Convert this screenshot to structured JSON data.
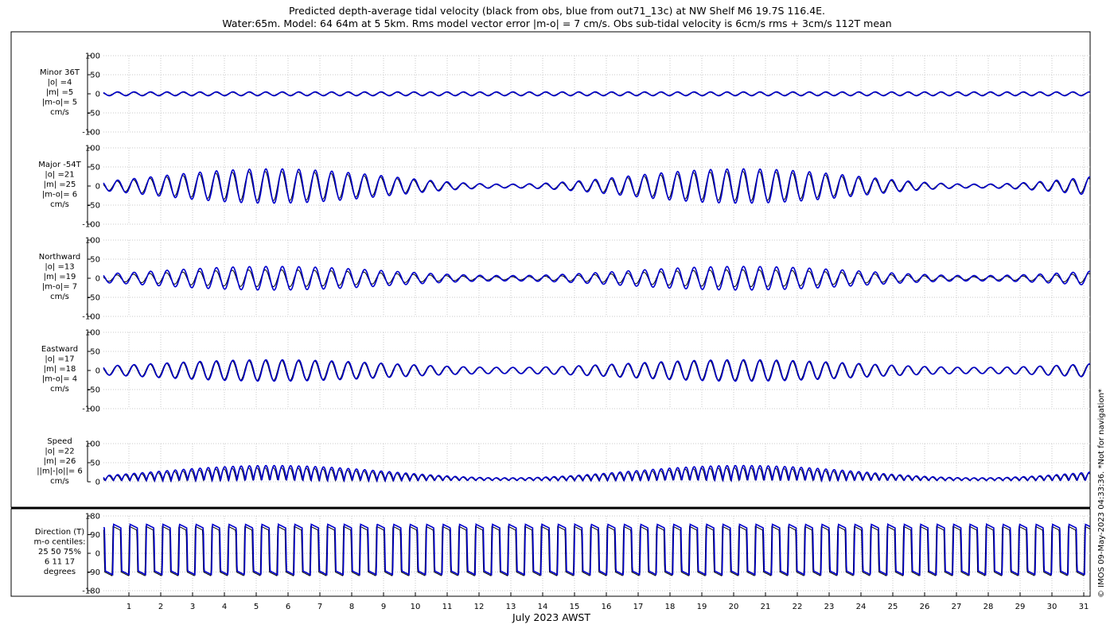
{
  "title": {
    "line1": "Predicted depth-average tidal velocity (black from obs, blue from out71_13c) at NW Shelf M6 19.7S 116.4E.",
    "line2": "Water:65m. Model: 64 64m at 5 5km. Rms model vector error |m-o| = 7 cm/s. Obs sub-tidal velocity is 6cm/s rms + 3cm/s 112T mean"
  },
  "footer": "© IMOS 09-May-2023 04:33:36. *Not for navigation*",
  "colors": {
    "obs": "#000000",
    "model": "#0000cc",
    "grid": "#c8c8c8"
  },
  "chart_data": {
    "type": "line",
    "xlabel": "July 2023 AWST",
    "xticks": [
      1,
      2,
      3,
      4,
      5,
      6,
      7,
      8,
      9,
      10,
      11,
      12,
      13,
      14,
      15,
      16,
      17,
      18,
      19,
      20,
      21,
      22,
      23,
      24,
      25,
      26,
      27,
      28,
      29,
      30,
      31
    ],
    "xlim": [
      0.2,
      31.2
    ],
    "grid": true,
    "series_legend": {
      "obs": "black from obs",
      "model": "blue from out71_13c"
    },
    "panels": [
      {
        "id": "minor",
        "label": [
          "Minor 36T",
          "|o| =4",
          "|m| =5",
          "|m-o|= 5",
          "cm/s"
        ],
        "ylim": [
          -100,
          100
        ],
        "yticks": [
          -100,
          -50,
          0,
          50,
          100
        ],
        "model": {
          "kind": "wave",
          "amp": 5,
          "spring_amp": 0,
          "offset": 0
        },
        "obs": {
          "kind": "wave",
          "amp": 4,
          "spring_amp": 0,
          "offset": 0
        }
      },
      {
        "id": "major",
        "label": [
          "Major -54T",
          "|o| =21",
          "|m| =25",
          "|m-o|= 6",
          "cm/s"
        ],
        "ylim": [
          -100,
          100
        ],
        "yticks": [
          -100,
          -50,
          0,
          50,
          100
        ],
        "model": {
          "kind": "wave",
          "amp": 25,
          "spring_amp": 20,
          "offset": 0
        },
        "obs": {
          "kind": "wave",
          "amp": 21,
          "spring_amp": 17,
          "offset": 0
        }
      },
      {
        "id": "northward",
        "label": [
          "Northward",
          "|o| =13",
          "|m| =19",
          "|m-o|= 7",
          "cm/s"
        ],
        "ylim": [
          -100,
          100
        ],
        "yticks": [
          -100,
          -50,
          0,
          50,
          100
        ],
        "model": {
          "kind": "wave",
          "amp": 19,
          "spring_amp": 12,
          "offset": 0
        },
        "obs": {
          "kind": "wave",
          "amp": 13,
          "spring_amp": 9,
          "offset": 0
        }
      },
      {
        "id": "eastward",
        "label": [
          "Eastward",
          "|o| =17",
          "|m| =18",
          "|m-o|= 4",
          "cm/s"
        ],
        "ylim": [
          -100,
          100
        ],
        "yticks": [
          -100,
          -50,
          0,
          50,
          100
        ],
        "model": {
          "kind": "wave",
          "amp": 18,
          "spring_amp": 10,
          "offset": 0
        },
        "obs": {
          "kind": "wave",
          "amp": 17,
          "spring_amp": 9,
          "offset": 0
        }
      },
      {
        "id": "speed",
        "label": [
          "Speed",
          "|o| =22",
          "|m| =26",
          "||m|-|o||= 6",
          "cm/s"
        ],
        "ylim": [
          0,
          100
        ],
        "yticks": [
          0,
          50,
          100
        ],
        "model": {
          "kind": "speed",
          "amp": 26,
          "spring_amp": 18,
          "offset": 0
        },
        "obs": {
          "kind": "speed",
          "amp": 22,
          "spring_amp": 15,
          "offset": 0
        }
      },
      {
        "id": "direction",
        "label": [
          "Direction (T)",
          "m-o centiles:",
          "25  50  75%",
          "6  11  17",
          "degrees"
        ],
        "ylim": [
          -180,
          180
        ],
        "yticks": [
          -180,
          -90,
          0,
          90,
          180
        ],
        "model": {
          "kind": "direction",
          "high": 140,
          "low": -85,
          "offset": 0
        },
        "obs": {
          "kind": "direction",
          "high": 130,
          "low": -90,
          "offset": 0
        }
      }
    ]
  }
}
